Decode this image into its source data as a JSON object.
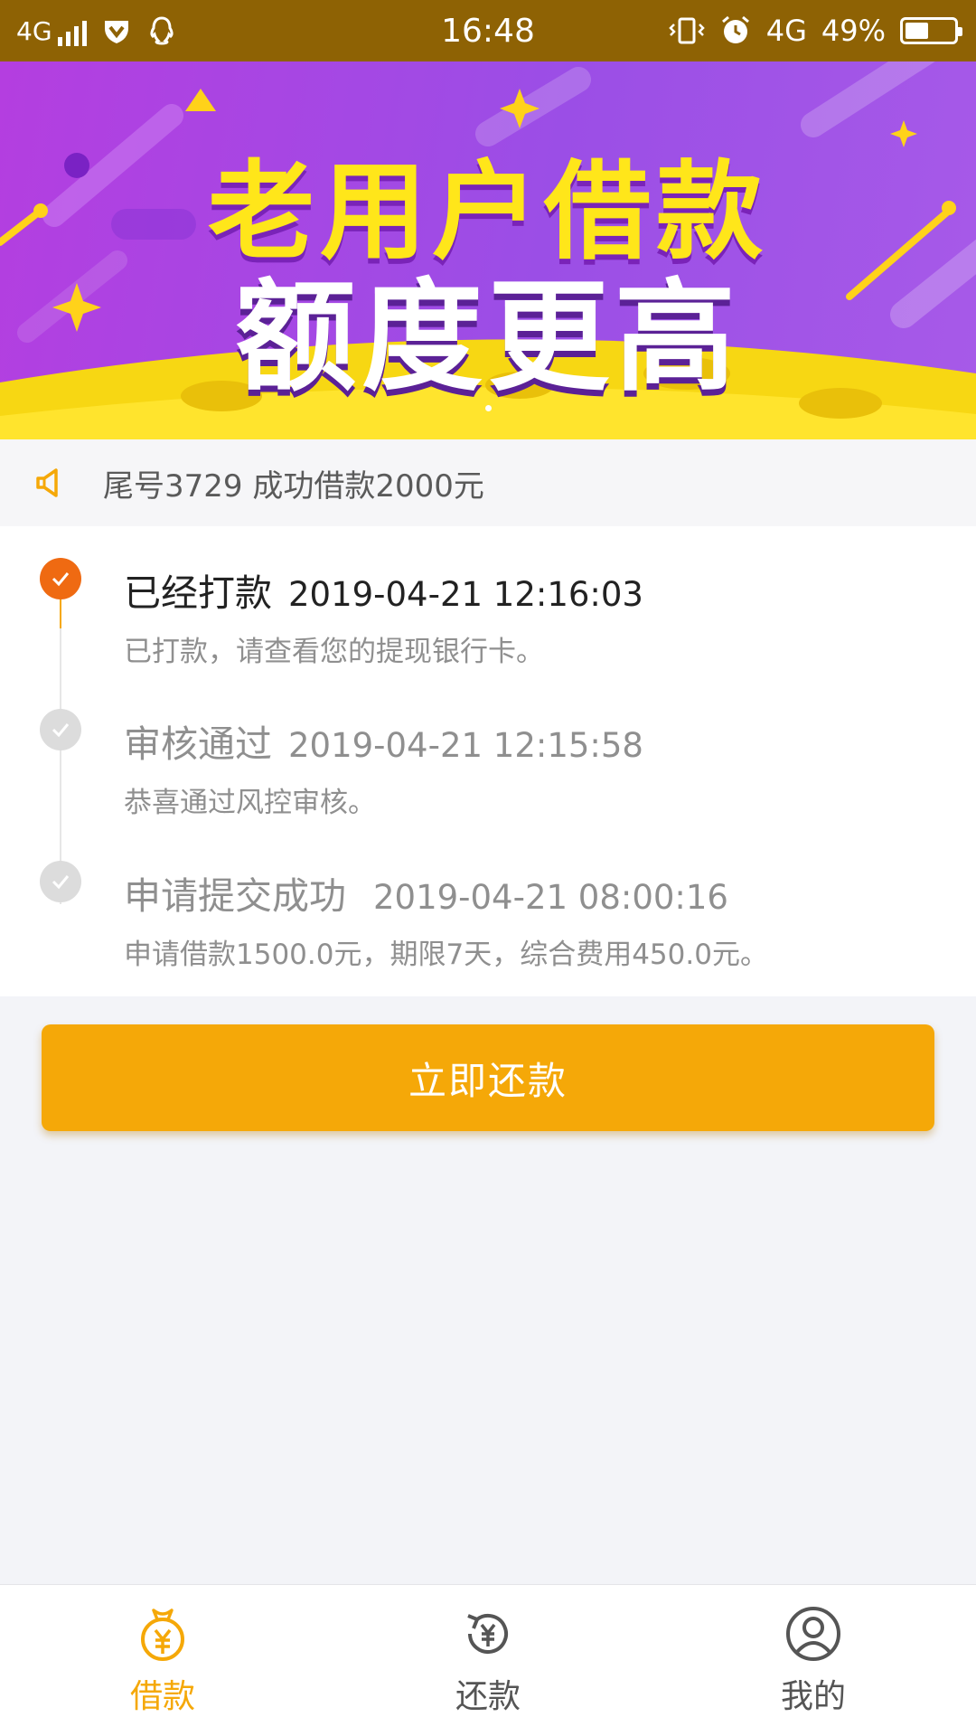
{
  "status_bar": {
    "network": "4G",
    "time": "16:48",
    "network2": "4G",
    "battery": "49%",
    "battery_level": 0.49,
    "icons": [
      "signal-icon",
      "vpn-shield-icon",
      "qq-icon",
      "vibrate-icon",
      "alarm-icon",
      "battery-icon"
    ]
  },
  "banner": {
    "line1": "老用户借款",
    "line2": "额度更高"
  },
  "notice": {
    "icon": "speaker-icon",
    "text": "尾号3729 成功借款2000元"
  },
  "timeline": [
    {
      "title": "已经打款",
      "time": "2019-04-21 12:16:03",
      "desc": "已打款，请查看您的提现银行卡。",
      "state": "active"
    },
    {
      "title": "审核通过",
      "time": "2019-04-21 12:15:58",
      "desc": "恭喜通过风控审核。",
      "state": "done"
    },
    {
      "title": "申请提交成功",
      "time": "2019-04-21 08:00:16",
      "desc": "申请借款1500.0元，期限7天，综合费用450.0元。",
      "state": "done"
    }
  ],
  "repay_button": "立即还款",
  "bottom_nav": [
    {
      "label": "借款",
      "icon": "money-bag-icon",
      "active": true
    },
    {
      "label": "还款",
      "icon": "repay-cycle-icon",
      "active": false
    },
    {
      "label": "我的",
      "icon": "user-icon",
      "active": false
    }
  ],
  "colors": {
    "status_bar": "#8e6204",
    "accent": "#f5a808",
    "active_dot": "#ef6a12",
    "done_dot": "#dcdcdc",
    "nav_active": "#f5a808",
    "nav_inactive": "#555555"
  }
}
